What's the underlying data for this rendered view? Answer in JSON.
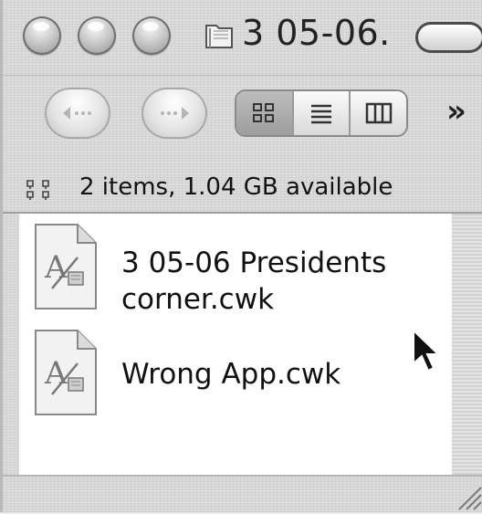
{
  "window": {
    "title": "3 05-06."
  },
  "icons": {
    "close": "close-button-icon",
    "minimize": "minimize-button-icon",
    "zoom": "zoom-button-icon",
    "folder": "folder-icon",
    "back": "back-arrow-icon",
    "forward": "forward-arrow-icon",
    "icon_view": "icon-view-icon",
    "list_view": "list-view-icon",
    "column_view": "column-view-icon",
    "more": "chevron-double-right-icon",
    "file": "appleworks-document-icon",
    "cursor": "mouse-pointer-icon"
  },
  "toolbar": {
    "active_view": "icon",
    "more_label": "»"
  },
  "status": {
    "text": "2 items, 1.04 GB available"
  },
  "files": [
    {
      "line1": "3 05-06 Presidents",
      "line2": "corner.cwk"
    },
    {
      "line1": "Wrong App.cwk",
      "line2": ""
    }
  ]
}
